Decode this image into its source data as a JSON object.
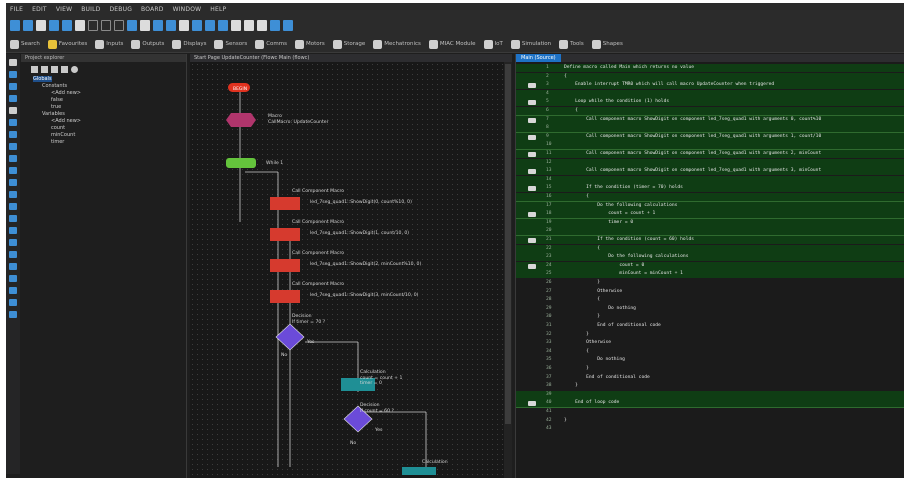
{
  "menu": [
    "FILE",
    "EDIT",
    "VIEW",
    "BUILD",
    "DEBUG",
    "BOARD",
    "WINDOW",
    "HELP"
  ],
  "toolbar2": [
    {
      "label": "Search",
      "icon": "search-icon",
      "color": "#cfcfcf"
    },
    {
      "label": "Favourites",
      "icon": "star-icon",
      "color": "#e8c23a"
    },
    {
      "label": "Inputs",
      "icon": "input-icon",
      "color": "#cfcfcf"
    },
    {
      "label": "Outputs",
      "icon": "output-icon",
      "color": "#cfcfcf"
    },
    {
      "label": "Displays",
      "icon": "display-icon",
      "color": "#cfcfcf"
    },
    {
      "label": "Sensors",
      "icon": "sensor-icon",
      "color": "#cfcfcf"
    },
    {
      "label": "Comms",
      "icon": "comms-icon",
      "color": "#cfcfcf"
    },
    {
      "label": "Motors",
      "icon": "motor-icon",
      "color": "#cfcfcf"
    },
    {
      "label": "Storage",
      "icon": "storage-icon",
      "color": "#cfcfcf"
    },
    {
      "label": "Mechatronics",
      "icon": "mechatronics-icon",
      "color": "#cfcfcf"
    },
    {
      "label": "MIAC Module",
      "icon": "miac-icon",
      "color": "#cfcfcf"
    },
    {
      "label": "IoT",
      "icon": "iot-icon",
      "color": "#cfcfcf"
    },
    {
      "label": "Simulation",
      "icon": "simulation-icon",
      "color": "#cfcfcf"
    },
    {
      "label": "Tools",
      "icon": "tools-icon",
      "color": "#cfcfcf"
    },
    {
      "label": "Shapes",
      "icon": "shapes-icon",
      "color": "#cfcfcf"
    }
  ],
  "explorer": {
    "title": "Project explorer",
    "tree": [
      {
        "label": "Globals",
        "indent": 0,
        "selected": true
      },
      {
        "label": "Constants",
        "indent": 1
      },
      {
        "label": "<Add new>",
        "indent": 2
      },
      {
        "label": "false",
        "indent": 2
      },
      {
        "label": "true",
        "indent": 2
      },
      {
        "label": "Variables",
        "indent": 1
      },
      {
        "label": "<Add new>",
        "indent": 2
      },
      {
        "label": "count",
        "indent": 2
      },
      {
        "label": "minCount",
        "indent": 2
      },
      {
        "label": "timer",
        "indent": 2
      }
    ]
  },
  "flow": {
    "tab": "Start Page   UpdateCounter (Flowc   Main (flowc)",
    "begin": "BEGIN",
    "nodes": {
      "macro": "Macro\nCallMacro: UpdateCounter",
      "loop": "While 1",
      "c1": "led_7seg_quad1::ShowDigit(0, count%10, 0)",
      "c2": "led_7seg_quad1::ShowDigit(1, count/10, 0)",
      "c3": "led_7seg_quad1::ShowDigit(2, minCount%10, 0)",
      "c4": "led_7seg_quad1::ShowDigit(3, minCount/10, 0)",
      "callLabel": "Call Component Macro",
      "d1": "Decision\nIf timer = 70 ?",
      "calc": "Calculation\ncount = count + 1\ntimer = 0",
      "d2": "Decision\nIf count = 60 ?",
      "yes": "Yes",
      "no": "No",
      "calc2": "Calculation"
    }
  },
  "code": {
    "tab": "Main (Source)",
    "lines": [
      {
        "n": "1",
        "t": "Define macro called Main which returns no value",
        "hl": true
      },
      {
        "n": "2",
        "t": "{",
        "hl": true
      },
      {
        "n": "3",
        "t": "    Enable interrupt TMR0 which will call macro UpdateCounter when triggered",
        "hl": true,
        "icon": true
      },
      {
        "n": "4",
        "t": "",
        "hl": true
      },
      {
        "n": "5",
        "t": "    Loop while the condition (1) holds",
        "hl": true,
        "icon": true
      },
      {
        "n": "6",
        "t": "    {",
        "hl": true
      },
      {
        "n": "7",
        "t": "        Call component macro ShowDigit on component led_7seg_quad1 with arguments 0, count%10",
        "hl": true,
        "icon": true
      },
      {
        "n": "8",
        "t": "",
        "hl": true
      },
      {
        "n": "9",
        "t": "        Call component macro ShowDigit on component led_7seg_quad1 with arguments 1, count/10",
        "hl": true,
        "icon": true
      },
      {
        "n": "10",
        "t": "",
        "hl": true
      },
      {
        "n": "11",
        "t": "        Call component macro ShowDigit on component led_7seg_quad1 with arguments 2, minCount",
        "hl": true,
        "icon": true
      },
      {
        "n": "12",
        "t": "",
        "hl": true
      },
      {
        "n": "13",
        "t": "        Call component macro ShowDigit on component led_7seg_quad1 with arguments 3, minCount",
        "hl": true,
        "icon": true
      },
      {
        "n": "14",
        "t": "",
        "hl": true
      },
      {
        "n": "15",
        "t": "        If the condition (timer = 70) holds",
        "hl": true,
        "icon": true
      },
      {
        "n": "16",
        "t": "        {",
        "hl": true
      },
      {
        "n": "17",
        "t": "            Do the following calculations",
        "hl": true
      },
      {
        "n": "18",
        "t": "                count = count + 1",
        "hl": true,
        "icon": true
      },
      {
        "n": "19",
        "t": "                timer = 0",
        "hl": true
      },
      {
        "n": "20",
        "t": "",
        "hl": true
      },
      {
        "n": "21",
        "t": "            If the condition (count = 60) holds",
        "hl": true,
        "icon": true
      },
      {
        "n": "22",
        "t": "            {",
        "hl": true
      },
      {
        "n": "23",
        "t": "                Do the following calculations",
        "hl": true
      },
      {
        "n": "24",
        "t": "                    count = 0",
        "hl": true,
        "icon": true
      },
      {
        "n": "25",
        "t": "                    minCount = minCount + 1",
        "hl": true
      },
      {
        "n": "26",
        "t": "            }",
        "hl": false
      },
      {
        "n": "27",
        "t": "            Otherwise",
        "hl": false
      },
      {
        "n": "28",
        "t": "            {",
        "hl": false
      },
      {
        "n": "29",
        "t": "                Do nothing",
        "hl": false
      },
      {
        "n": "30",
        "t": "            }",
        "hl": false
      },
      {
        "n": "31",
        "t": "            End of conditional code",
        "hl": false
      },
      {
        "n": "32",
        "t": "        }",
        "hl": false
      },
      {
        "n": "33",
        "t": "        Otherwise",
        "hl": false
      },
      {
        "n": "34",
        "t": "        {",
        "hl": false
      },
      {
        "n": "35",
        "t": "            Do nothing",
        "hl": false
      },
      {
        "n": "36",
        "t": "        }",
        "hl": false
      },
      {
        "n": "37",
        "t": "        End of conditional code",
        "hl": false
      },
      {
        "n": "38",
        "t": "    }",
        "hl": false
      },
      {
        "n": "39",
        "t": "",
        "hl": true
      },
      {
        "n": "40",
        "t": "    End of loop code",
        "hl": true,
        "icon": true
      },
      {
        "n": "41",
        "t": "",
        "hl": false
      },
      {
        "n": "42",
        "t": "}",
        "hl": false
      },
      {
        "n": "43",
        "t": "",
        "hl": false
      }
    ]
  },
  "colors": {
    "begin": "#e0321f",
    "macro": "#b0356c",
    "loop": "#64c43c",
    "call": "#d63a2e",
    "decision": "#6b4bd9",
    "calc": "#1f8f95",
    "codehl": "#0f3d14",
    "accent": "#1e72c6"
  }
}
